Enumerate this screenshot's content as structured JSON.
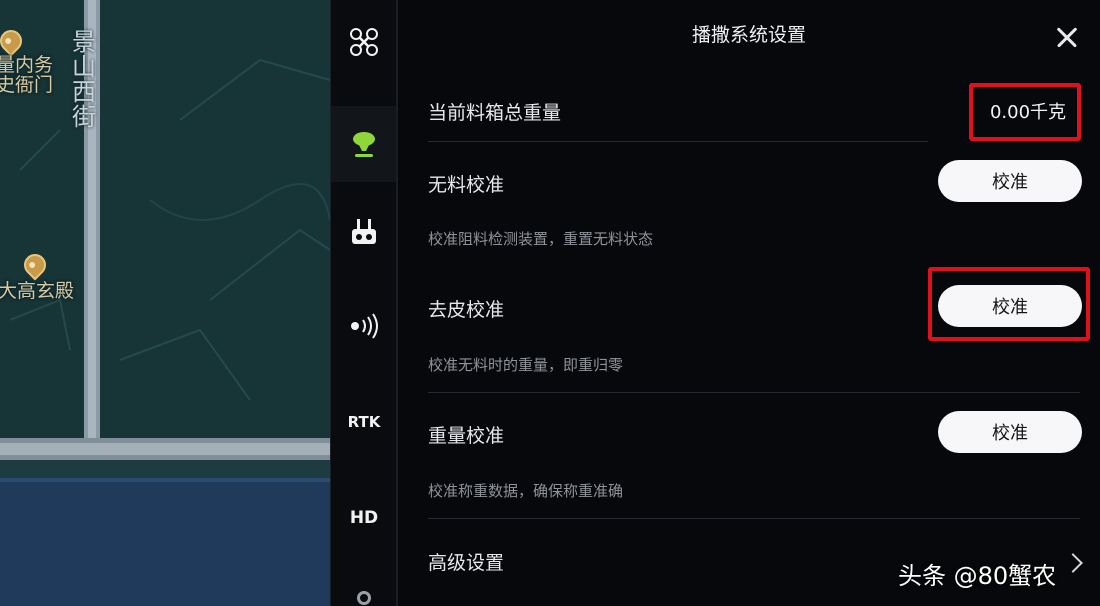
{
  "map": {
    "labels": [
      "量内务",
      "史衙门",
      "大高玄殿"
    ],
    "street": "景山西街"
  },
  "rail": {
    "items": [
      {
        "name": "drone-icon"
      },
      {
        "name": "spreader-icon",
        "active": true
      },
      {
        "name": "remote-controller-icon"
      },
      {
        "name": "radar-signal-icon"
      },
      {
        "name": "rtk-icon",
        "label": "RTK"
      },
      {
        "name": "hd-icon",
        "label": "HD"
      }
    ]
  },
  "panel": {
    "title": "播撒系统设置",
    "rows": [
      {
        "label": "当前料箱总重量",
        "value": "0.00千克"
      },
      {
        "label": "无料校准",
        "button": "校准",
        "desc": "校准阻料检测装置，重置无料状态"
      },
      {
        "label": "去皮校准",
        "button": "校准",
        "desc": "校准无料时的重量，即重归零"
      },
      {
        "label": "重量校准",
        "button": "校准",
        "desc": "校准称重数据，确保称重准确"
      },
      {
        "label": "高级设置"
      }
    ]
  },
  "colors": {
    "highlight": "#e0111c",
    "accent_green": "#8fd63a"
  },
  "watermark": "头条 @80蟹农"
}
